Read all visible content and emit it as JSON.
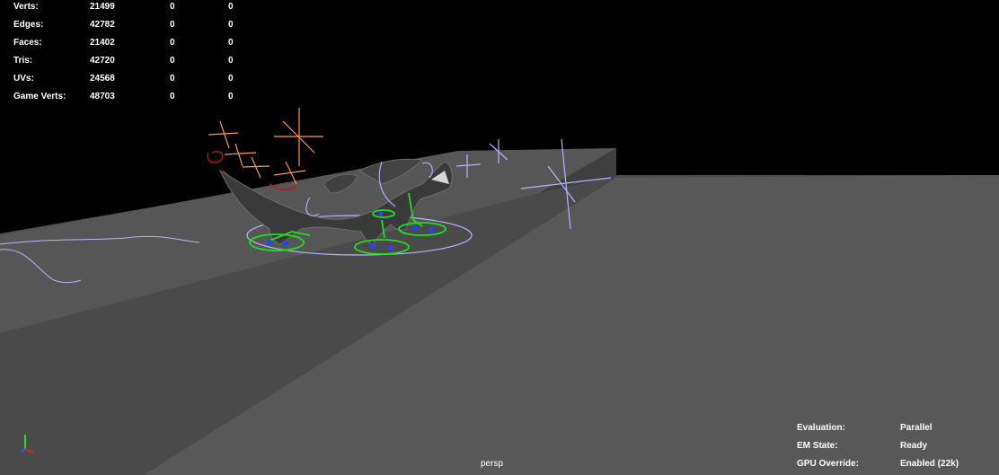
{
  "stats": [
    {
      "label": "Verts:",
      "v1": "21499",
      "v2": "0",
      "v3": "0"
    },
    {
      "label": "Edges:",
      "v1": "42782",
      "v2": "0",
      "v3": "0"
    },
    {
      "label": "Faces:",
      "v1": "21402",
      "v2": "0",
      "v3": "0"
    },
    {
      "label": "Tris:",
      "v1": "42720",
      "v2": "0",
      "v3": "0"
    },
    {
      "label": "UVs:",
      "v1": "24568",
      "v2": "0",
      "v3": "0"
    },
    {
      "label": "Game Verts:",
      "v1": "48703",
      "v2": "0",
      "v3": "0"
    }
  ],
  "status": [
    {
      "label": "Evaluation:",
      "value": "Parallel"
    },
    {
      "label": "EM State:",
      "value": "Ready"
    },
    {
      "label": "GPU Override:",
      "value": "Enabled (22k)"
    }
  ],
  "camera": "persp",
  "colors": {
    "background": "#000000",
    "ground_top": "#4f4f4f",
    "ledge_top": "#535353",
    "ledge_face": "#454545",
    "floor": "#555555",
    "control_green": "#22dd22",
    "control_lavender": "#b9b4ff",
    "control_orange": "#ff9a55",
    "control_red": "#b81818"
  },
  "icons": {
    "axis": "axis-gizmo-icon",
    "creature": "dragon-model"
  }
}
